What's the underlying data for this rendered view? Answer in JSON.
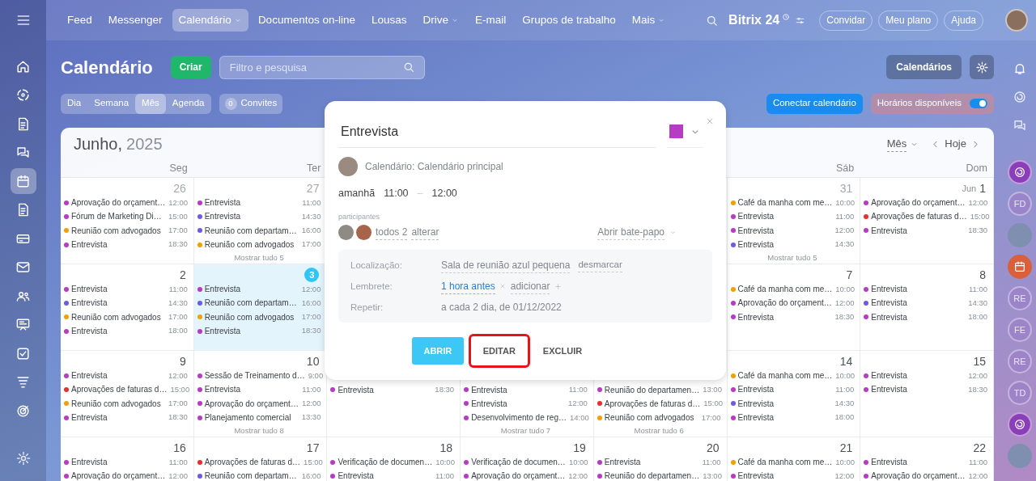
{
  "top_nav": {
    "items": [
      {
        "label": "Feed",
        "selected": false,
        "dropdown": false
      },
      {
        "label": "Messenger",
        "selected": false,
        "dropdown": false
      },
      {
        "label": "Calendário",
        "selected": true,
        "dropdown": true
      },
      {
        "label": "Documentos on-line",
        "selected": false,
        "dropdown": false
      },
      {
        "label": "Lousas",
        "selected": false,
        "dropdown": false
      },
      {
        "label": "Drive",
        "selected": false,
        "dropdown": true
      },
      {
        "label": "E-mail",
        "selected": false,
        "dropdown": false
      },
      {
        "label": "Grupos de trabalho",
        "selected": false,
        "dropdown": false
      },
      {
        "label": "Mais",
        "selected": false,
        "dropdown": true
      }
    ],
    "logo": "Bitrix 24",
    "buttons": [
      "Convidar",
      "Meu plano",
      "Ajuda"
    ]
  },
  "left_sidebar": {
    "items": [
      {
        "selected": false
      },
      {
        "selected": false
      },
      {
        "selected": false
      },
      {
        "selected": false
      },
      {
        "selected": true
      },
      {
        "selected": false
      },
      {
        "selected": false
      },
      {
        "selected": false
      },
      {
        "selected": false
      },
      {
        "selected": false
      },
      {
        "selected": false
      },
      {
        "selected": false
      },
      {
        "selected": false
      }
    ]
  },
  "right_rail": [
    {
      "kind": "bell"
    },
    {
      "kind": "spiral"
    },
    {
      "kind": "chat"
    },
    {
      "kind": "app"
    },
    {
      "kind": "initials",
      "text": "FD"
    },
    {
      "kind": "photo"
    },
    {
      "kind": "calendar_app"
    },
    {
      "kind": "initials",
      "text": "RE"
    },
    {
      "kind": "initials",
      "text": "FE"
    },
    {
      "kind": "initials",
      "text": "RE"
    },
    {
      "kind": "initials",
      "text": "TD"
    },
    {
      "kind": "app"
    },
    {
      "kind": "photo"
    }
  ],
  "toolbar": {
    "title": "Calendário",
    "create_button": "Criar",
    "search": {
      "placeholder": "Filtro e pesquisa"
    },
    "calendars_button": "Calendários",
    "views": [
      {
        "label": "Dia",
        "selected": false
      },
      {
        "label": "Semana",
        "selected": false
      },
      {
        "label": "Mês",
        "selected": true
      },
      {
        "label": "Agenda",
        "selected": false
      }
    ],
    "invites": {
      "count": "0",
      "label": "Convites"
    },
    "connect_button": "Conectar calendário",
    "availability": {
      "label": "Horários disponíveis",
      "on": true
    }
  },
  "calendar": {
    "month": "Junho,",
    "year": "2025",
    "view_select": "Mês",
    "today_button": "Hoje",
    "columns": [
      {
        "name": "Seg"
      },
      {
        "name": "Ter"
      },
      {},
      {},
      {},
      {
        "name": "Sáb"
      },
      {
        "name": "Dom"
      }
    ],
    "weeks": [
      {
        "cells": [
          {
            "day": "26",
            "other_month": true,
            "today": false,
            "events": [
              {
                "title": "Aprovação do orçament…",
                "time": "12:00",
                "color": "#b53cc3"
              },
              {
                "title": "Fórum de Marketing Di…",
                "time": "15:00",
                "color": "#b53cc3"
              },
              {
                "title": "Reunião com advogados",
                "time": "17:00",
                "color": "#f0a000"
              },
              {
                "title": "Entrevista",
                "time": "18:30",
                "color": "#b53cc3"
              }
            ]
          },
          {
            "day": "27",
            "other_month": true,
            "today": false,
            "events": [
              {
                "title": "Entrevista",
                "time": "11:00",
                "color": "#b53cc3"
              },
              {
                "title": "Entrevista",
                "time": "14:30",
                "color": "#6b5ce0"
              },
              {
                "title": "Reunião com departam…",
                "time": "16:00",
                "color": "#6b5ce0"
              },
              {
                "title": "Reunião com advogados",
                "time": "17:00",
                "color": "#f0a000"
              }
            ],
            "more": "Mostrar tudo 5"
          },
          {},
          {},
          {},
          {
            "day": "31",
            "other_month": true,
            "today": false,
            "events": [
              {
                "title": "Café da manha com me…",
                "time": "10:00",
                "color": "#f0a000"
              },
              {
                "title": "Entrevista",
                "time": "11:00",
                "color": "#b53cc3"
              },
              {
                "title": "Entrevista",
                "time": "12:00",
                "color": "#b53cc3"
              },
              {
                "title": "Entrevista",
                "time": "14:30",
                "color": "#6b5ce0"
              }
            ],
            "more": "Mostrar tudo 5"
          },
          {
            "month": "Jun",
            "day": "1",
            "other_month": false,
            "today": false,
            "events": [
              {
                "title": "Aprovação do orçament…",
                "time": "12:00",
                "color": "#b53cc3"
              },
              {
                "title": "Aprovações de faturas d…",
                "time": "15:00",
                "color": "#e5302d"
              },
              {
                "title": "Entrevista",
                "time": "18:30",
                "color": "#b53cc3"
              }
            ]
          }
        ]
      },
      {
        "cells": [
          {
            "day": "2",
            "other_month": false,
            "today": false,
            "events": [
              {
                "title": "Entrevista",
                "time": "11:00",
                "color": "#b53cc3"
              },
              {
                "title": "Entrevista",
                "time": "14:30",
                "color": "#6b5ce0"
              },
              {
                "title": "Reunião com advogados",
                "time": "17:00",
                "color": "#f0a000"
              },
              {
                "title": "Entrevista",
                "time": "18:00",
                "color": "#b53cc3"
              }
            ]
          },
          {
            "day": "3",
            "other_month": false,
            "today": true,
            "events": [
              {
                "title": "Entrevista",
                "time": "12:00",
                "color": "#b53cc3"
              },
              {
                "title": "Reunião com departam…",
                "time": "16:00",
                "color": "#6b5ce0"
              },
              {
                "title": "Reunião com advogados",
                "time": "17:00",
                "color": "#f0a000"
              },
              {
                "title": "Entrevista",
                "time": "18:30",
                "color": "#b53cc3"
              }
            ]
          },
          {},
          {},
          {},
          {
            "day": "7",
            "other_month": false,
            "today": false,
            "events": [
              {
                "title": "Café da manha com me…",
                "time": "10:00",
                "color": "#f0a000"
              },
              {
                "title": "Aprovação do orçament…",
                "time": "12:00",
                "color": "#b53cc3"
              },
              {
                "title": "Entrevista",
                "time": "18:30",
                "color": "#b53cc3"
              }
            ]
          },
          {
            "day": "8",
            "other_month": false,
            "today": false,
            "events": [
              {
                "title": "Entrevista",
                "time": "11:00",
                "color": "#b53cc3"
              },
              {
                "title": "Entrevista",
                "time": "14:30",
                "color": "#6b5ce0"
              },
              {
                "title": "Entrevista",
                "time": "18:00",
                "color": "#b53cc3"
              }
            ]
          }
        ]
      },
      {
        "cells": [
          {
            "day": "9",
            "other_month": false,
            "today": false,
            "events": [
              {
                "title": "Entrevista",
                "time": "12:00",
                "color": "#b53cc3"
              },
              {
                "title": "Aprovações de faturas d…",
                "time": "15:00",
                "color": "#e5302d"
              },
              {
                "title": "Reunião com advogados",
                "time": "17:00",
                "color": "#f0a000"
              },
              {
                "title": "Entrevista",
                "time": "18:30",
                "color": "#b53cc3"
              }
            ]
          },
          {
            "day": "10",
            "other_month": false,
            "today": false,
            "events": [
              {
                "title": "Sessão de Treinamento d…",
                "time": "9:00",
                "color": "#b53cc3"
              },
              {
                "title": "Entrevista",
                "time": "11:00",
                "color": "#b53cc3"
              },
              {
                "title": "Aprovação do orçament…",
                "time": "12:00",
                "color": "#b53cc3"
              },
              {
                "title": "Planejamento comercial",
                "time": "13:30",
                "color": "#b53cc3"
              }
            ],
            "more": "Mostrar tudo 8"
          },
          {
            "events": [
              {
                "title": "Entrevista",
                "time": "18:30",
                "color": "#b53cc3"
              }
            ]
          },
          {
            "events": [
              {
                "title": "Entrevista",
                "time": "11:00",
                "color": "#b53cc3"
              },
              {
                "title": "Entrevista",
                "time": "12:00",
                "color": "#b53cc3"
              },
              {
                "title": "Desenvolvimento de reg…",
                "time": "14:00",
                "color": "#b53cc3"
              }
            ],
            "more": "Mostrar tudo 7"
          },
          {
            "events": [
              {
                "title": "Reunião do departamen…",
                "time": "13:00",
                "color": "#b53cc3"
              },
              {
                "title": "Aprovações de faturas d…",
                "time": "15:00",
                "color": "#e5302d"
              },
              {
                "title": "Reunião com advogados",
                "time": "17:00",
                "color": "#f0a000"
              }
            ],
            "more": "Mostrar tudo 6"
          },
          {
            "day": "14",
            "other_month": false,
            "today": false,
            "events": [
              {
                "title": "Café da manha com me…",
                "time": "10:00",
                "color": "#f0a000"
              },
              {
                "title": "Entrevista",
                "time": "11:00",
                "color": "#b53cc3"
              },
              {
                "title": "Entrevista",
                "time": "14:30",
                "color": "#6b5ce0"
              },
              {
                "title": "Entrevista",
                "time": "18:00",
                "color": "#b53cc3"
              }
            ]
          },
          {
            "day": "15",
            "other_month": false,
            "today": false,
            "events": [
              {
                "title": "Entrevista",
                "time": "12:00",
                "color": "#b53cc3"
              },
              {
                "title": "Entrevista",
                "time": "18:30",
                "color": "#b53cc3"
              }
            ]
          }
        ]
      },
      {
        "cells": [
          {
            "day": "16",
            "other_month": false,
            "today": false,
            "events": [
              {
                "title": "Entrevista",
                "time": "11:00",
                "color": "#b53cc3"
              },
              {
                "title": "Aprovação do orçament…",
                "time": "12:00",
                "color": "#b53cc3"
              }
            ]
          },
          {
            "day": "17",
            "other_month": false,
            "today": false,
            "events": [
              {
                "title": "Aprovações de faturas d…",
                "time": "15:00",
                "color": "#e5302d"
              },
              {
                "title": "Reunião com departam…",
                "time": "16:00",
                "color": "#6b5ce0"
              }
            ]
          },
          {
            "day": "18",
            "other_month": false,
            "today": false,
            "events": [
              {
                "title": "Verificação de documen…",
                "time": "10:00",
                "color": "#b53cc3"
              },
              {
                "title": "Entrevista",
                "time": "11:00",
                "color": "#b53cc3"
              }
            ]
          },
          {
            "day": "19",
            "other_month": false,
            "today": false,
            "events": [
              {
                "title": "Verificação de documen…",
                "time": "10:00",
                "color": "#b53cc3"
              },
              {
                "title": "Aprovação do orçament…",
                "time": "12:00",
                "color": "#b53cc3"
              }
            ]
          },
          {
            "day": "20",
            "other_month": false,
            "today": false,
            "events": [
              {
                "title": "Entrevista",
                "time": "11:00",
                "color": "#b53cc3"
              },
              {
                "title": "Reunião do departamen…",
                "time": "13:00",
                "color": "#b53cc3"
              }
            ]
          },
          {
            "day": "21",
            "other_month": false,
            "today": false,
            "events": [
              {
                "title": "Café da manha com me…",
                "time": "10:00",
                "color": "#f0a000"
              },
              {
                "title": "Entrevista",
                "time": "12:00",
                "color": "#b53cc3"
              }
            ]
          },
          {
            "day": "22",
            "other_month": false,
            "today": false,
            "events": [
              {
                "title": "Entrevista",
                "time": "11:00",
                "color": "#b53cc3"
              },
              {
                "title": "Aprovação do orçament…",
                "time": "12:00",
                "color": "#b53cc3"
              }
            ]
          }
        ]
      }
    ]
  },
  "event_popup": {
    "title": "Entrevista",
    "color": "#b53cc3",
    "calendar_label": "Calendário: Calendário principal",
    "date": "amanhã",
    "start": "11:00",
    "separator": "–",
    "end": "12:00",
    "participants_label": "participantes",
    "participants_count": "todos 2",
    "participants_action": "alterar",
    "chat_action": "Abrir bate-papo",
    "details": [
      {
        "kind": "location",
        "label": "Localização:",
        "value": "Sala de reunião azul pequena",
        "action": "desmarcar"
      },
      {
        "kind": "reminder",
        "label": "Lembrete:",
        "value": "1 hora antes",
        "action": "adicionar"
      },
      {
        "kind": "repeat",
        "label": "Repetir:",
        "value": "a cada 2 dia, de 01/12/2022"
      }
    ],
    "buttons": [
      {
        "label": "ABRIR",
        "kind": "primary",
        "highlighted": false
      },
      {
        "label": "EDITAR",
        "kind": "plain",
        "highlighted": true
      },
      {
        "label": "EXCLUIR",
        "kind": "plain",
        "highlighted": false
      }
    ]
  }
}
